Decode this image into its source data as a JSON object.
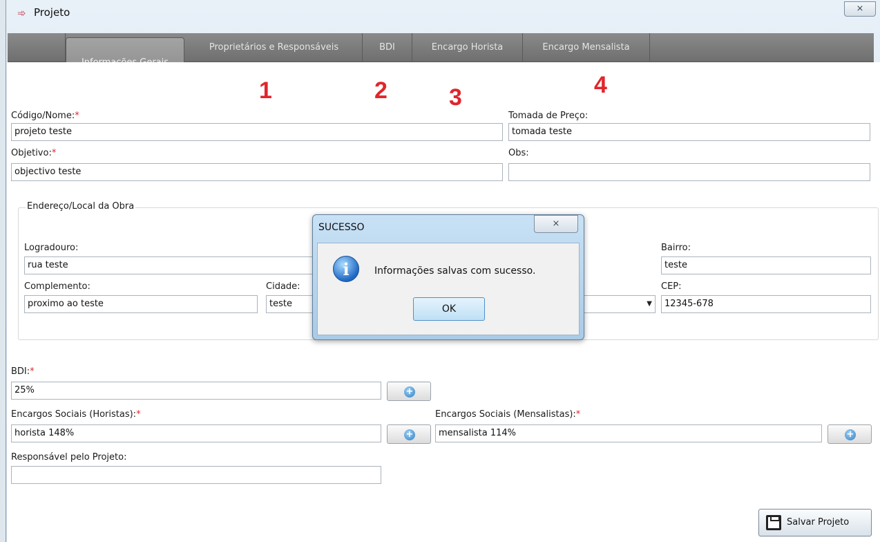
{
  "window": {
    "title": "Projeto",
    "close_symbol": "⨯"
  },
  "tabs": [
    {
      "label": "Informações Gerais",
      "active": true
    },
    {
      "label": "Proprietários e Responsáveis",
      "active": false
    },
    {
      "label": "BDI",
      "active": false
    },
    {
      "label": "Encargo Horista",
      "active": false
    },
    {
      "label": "Encargo Mensalista",
      "active": false
    }
  ],
  "annotations": [
    "1",
    "2",
    "3",
    "4"
  ],
  "form": {
    "codigo_label": "Código/Nome:",
    "codigo_value": "projeto teste",
    "tomada_label": "Tomada de Preço:",
    "tomada_value": "tomada teste",
    "objetivo_label": "Objetivo:",
    "objetivo_value": "objectivo teste",
    "obs_label": "Obs:",
    "obs_value": "",
    "required_mark": "*",
    "endereco": {
      "title": "Endereço/Local da Obra",
      "logradouro_label": "Logradouro:",
      "logradouro_value": "rua teste",
      "bairro_label": "Bairro:",
      "bairro_value": "teste",
      "complemento_label": "Complemento:",
      "complemento_value": "proximo ao teste",
      "cidade_label": "Cidade:",
      "cidade_value": "teste",
      "cep_label": "CEP:",
      "cep_value": "12345-678",
      "estado_value": ""
    },
    "bdi_label": "BDI:",
    "bdi_value": "25%",
    "horistas_label": "Encargos Sociais (Horistas):",
    "horistas_value": "horista 148%",
    "mensalistas_label": "Encargos Sociais (Mensalistas):",
    "mensalistas_value": "mensalista 114%",
    "responsavel_label": "Responsável pelo Projeto:",
    "responsavel_value": "",
    "save_label": "Salvar Projeto"
  },
  "dialog": {
    "title": "SUCESSO",
    "message": "Informações salvas com sucesso.",
    "ok_label": "OK",
    "close_symbol": "⨯"
  },
  "colors": {
    "required": "#e0262c",
    "annotation": "#e0262c",
    "tabbar": "#7c7c7c"
  }
}
